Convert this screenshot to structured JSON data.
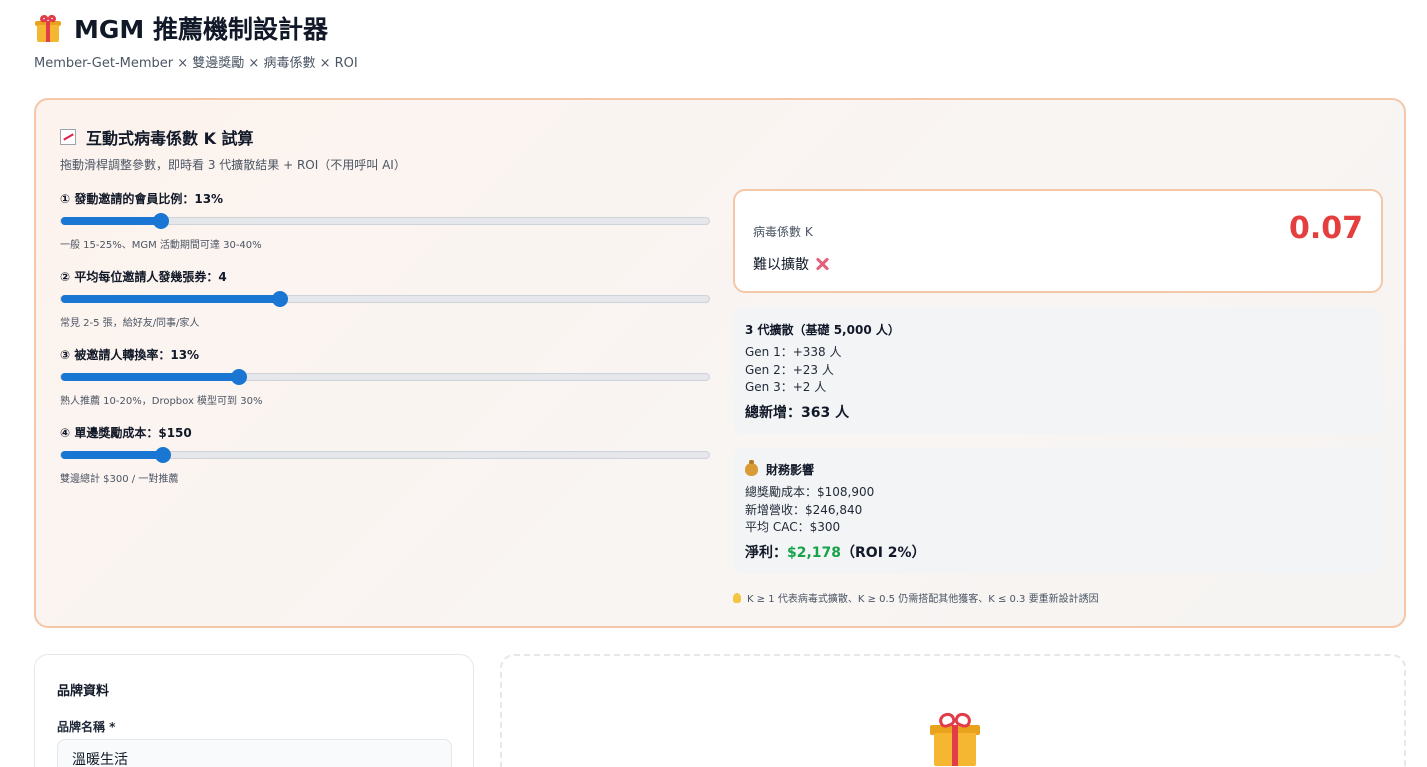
{
  "header": {
    "title": "MGM 推薦機制設計器",
    "subtitle": "Member-Get-Member × 雙邊獎勵 × 病毒係數 × ROI",
    "icon": "gift-icon"
  },
  "calculator": {
    "title": "互動式病毒係數 K 試算",
    "icon": "chart-increasing-icon",
    "description": "拖動滑桿調整參數，即時看 3 代擴散結果 + ROI（不用呼叫 AI）",
    "sliders": [
      {
        "label": "① 發動邀請的會員比例：",
        "value": "13%",
        "hint": "一般 15-25%、MGM 活動期間可達 30-40%",
        "fill_fraction": 0.154
      },
      {
        "label": "② 平均每位邀請人發幾張券：",
        "value": "4",
        "hint": "常見 2-5 張，給好友/同事/家人",
        "fill_fraction": 0.338
      },
      {
        "label": "③ 被邀請人轉換率：",
        "value": "13%",
        "hint": "熟人推薦 10-20%，Dropbox 模型可到 30%",
        "fill_fraction": 0.275
      },
      {
        "label": "④ 單邊獎勵成本：",
        "value": "$150",
        "hint": "雙邊總計 $300 / 一對推薦",
        "fill_fraction": 0.158
      }
    ],
    "k_result": {
      "label": "病毒係數 K",
      "value": "0.07",
      "status": "難以擴散",
      "status_icon": "cross-mark-icon",
      "value_color": "#e53e3e"
    },
    "diffusion": {
      "title": "3 代擴散（基礎 5,000 人）",
      "lines": [
        "Gen 1：+338 人",
        "Gen 2：+23 人",
        "Gen 3：+2 人"
      ],
      "total": "總新增：363 人"
    },
    "finance": {
      "icon": "money-bag-icon",
      "title": "財務影響",
      "lines": [
        "總獎勵成本：$108,900",
        "新增營收：$246,840",
        "平均 CAC：$300"
      ],
      "profit_label": "淨利：",
      "profit_value": "$2,178",
      "profit_roi": "（ROI 2%）"
    },
    "footnote": {
      "icon": "light-bulb-icon",
      "text": "K ≥ 1 代表病毒式擴散、K ≥ 0.5 仍需搭配其他獲客、K ≤ 0.3 要重新設計誘因"
    }
  },
  "brand_form": {
    "title": "品牌資料",
    "field_label": "品牌名稱 *",
    "field_value": "溫暖生活"
  },
  "result_panel": {
    "icon": "gift-icon"
  },
  "colors": {
    "accent": "#1976d2",
    "card_border": "#f4c7a8",
    "danger": "#e53e3e",
    "positive": "#16a34a"
  }
}
